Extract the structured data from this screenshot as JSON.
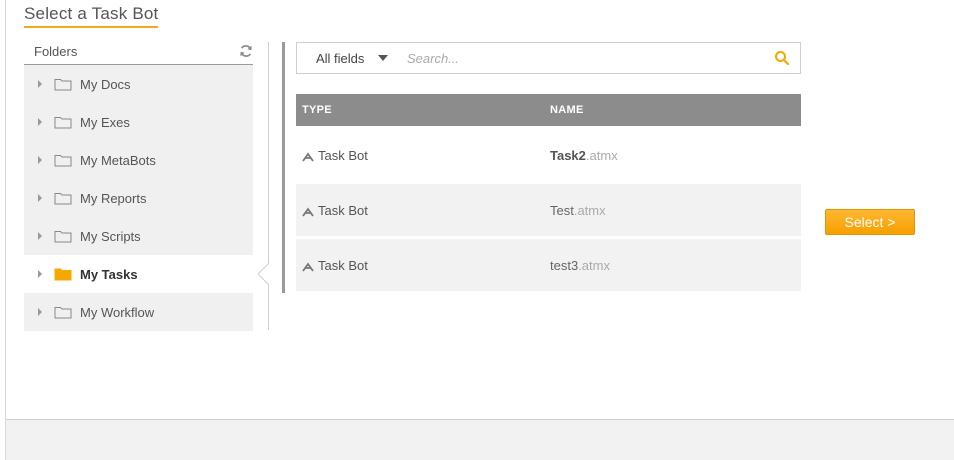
{
  "title": "Select a Task Bot",
  "folders": {
    "header": "Folders",
    "items": [
      {
        "label": "My Docs",
        "selected": false
      },
      {
        "label": "My Exes",
        "selected": false
      },
      {
        "label": "My MetaBots",
        "selected": false
      },
      {
        "label": "My Reports",
        "selected": false
      },
      {
        "label": "My Scripts",
        "selected": false
      },
      {
        "label": "My Tasks",
        "selected": true
      },
      {
        "label": "My Workflow",
        "selected": false
      }
    ]
  },
  "search": {
    "field_label": "All fields",
    "placeholder": "Search..."
  },
  "table": {
    "columns": [
      "TYPE",
      "NAME"
    ],
    "rows": [
      {
        "type": "Task Bot",
        "name": "Task2",
        "ext": ".atmx"
      },
      {
        "type": "Task Bot",
        "name": "Test",
        "ext": ".atmx"
      },
      {
        "type": "Task Bot",
        "name": "test3",
        "ext": ".atmx"
      }
    ]
  },
  "select_button": "Select >",
  "colors": {
    "accent": "#f5a623",
    "header_bg": "#8c8c8c",
    "folder_selected_icon": "#f5a800"
  },
  "icons": {
    "refresh": "refresh-icon",
    "folder": "folder-icon",
    "search": "search-icon",
    "bot": "bot-icon"
  }
}
